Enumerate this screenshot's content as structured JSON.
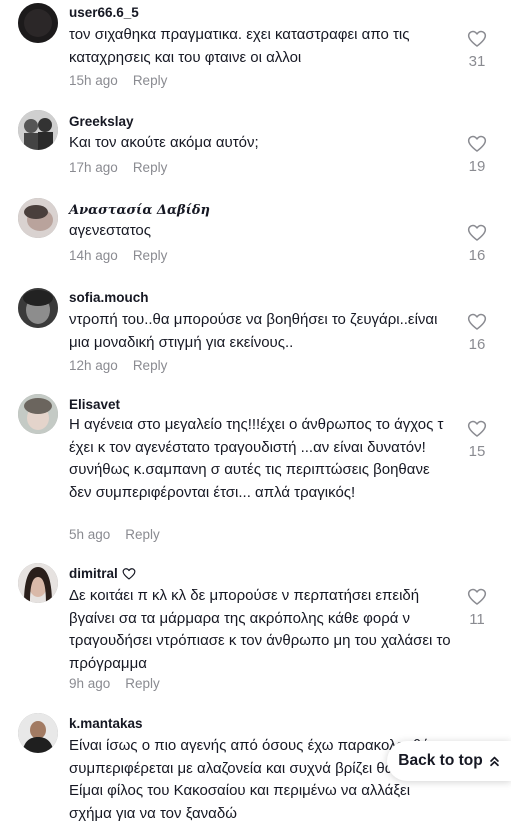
{
  "comments": [
    {
      "username": "user66.6_5",
      "text": "τον σιχαθηκα πραγματικα. εχει καταστραφει απο τις καταχρησεις και του φταινε οι αλλοι",
      "time": "15h ago",
      "reply": "Reply",
      "likes": "31"
    },
    {
      "username": "Greekslay",
      "text": "Και τον ακούτε ακόμα αυτόν;",
      "time": "17h ago",
      "reply": "Reply",
      "likes": "19"
    },
    {
      "username": "Αναστασία Δαβίδη",
      "text": "αγενεστατος",
      "time": "14h ago",
      "reply": "Reply",
      "likes": "16"
    },
    {
      "username": "sofia.mouch",
      "text": "ντροπή του..θα μπορούσε να βοηθήσει το ζευγάρι..είναι μια μοναδική στιγμή για εκείνους..",
      "time": "12h ago",
      "reply": "Reply",
      "likes": "16"
    },
    {
      "username": "Elisavet",
      "text": "Η αγένεια στο μεγαλείο της!!!έχει ο άνθρωπος το άγχος τ έχει κ τον αγενέστατο τραγουδιστή ...αν είναι δυνατόν!συνήθως κ.σαμπανη σ αυτές τις περιπτώσεις βοηθανε δεν συμπεριφέρονται έτσι... απλά τραγικός!",
      "time": "5h ago",
      "reply": "Reply",
      "likes": "15"
    },
    {
      "username": "dimitral",
      "text": "Δε κοιτάει π κλ κλ δε μπορούσε ν περπατήσει επειδή βγαίνει σα τα μάρμαρα της ακρόπολης κάθε φορά ν τραγουδήσει ντρόπιασε κ τον άνθρωπο μη του χαλάσει το πρόγραμμα",
      "time": "9h ago",
      "reply": "Reply",
      "likes": "11"
    },
    {
      "username": "k.mantakas",
      "text": "Είναι ίσως ο πιο αγενής από όσους έχω παρακολουθήσει, συμπεριφέρεται με αλαζονεία και συχνά βρίζει θαμόνες. Είμαι φίλος του Κακοσαίου και περιμένω να αλλάξει σχήμα για να τον ξαναδώ",
      "time": "",
      "reply": "",
      "likes": ""
    }
  ],
  "back_to_top": "Back to top",
  "icons": {
    "like": "heart-outline-icon",
    "badge": "heart-badge-icon",
    "back": "chevron-double-up-icon"
  },
  "colors": {
    "text": "#161823",
    "muted": "#8a8b91"
  }
}
